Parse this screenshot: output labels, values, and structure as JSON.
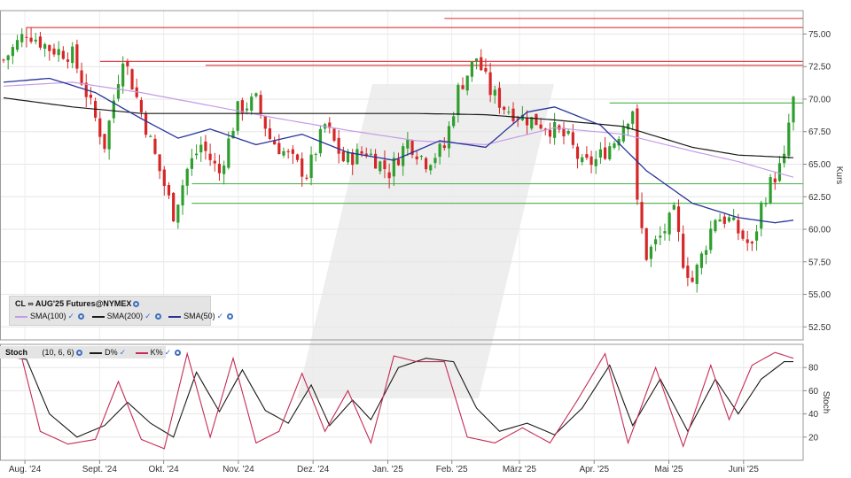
{
  "chart_data": [
    {
      "type": "candlestick",
      "title": "CL ∞ AUG'25 Futures@NYMEX",
      "ylabel": "Kurs",
      "ylim": [
        51.5,
        76.8
      ],
      "y_ticks": [
        "75.00",
        "72.50",
        "70.00",
        "67.50",
        "65.00",
        "62.50",
        "60.00",
        "57.50",
        "55.00",
        "52.50"
      ],
      "x_ticks": [
        "Aug. '24",
        "Sept. '24",
        "Okt. '24",
        "Nov. '24",
        "Dez. '24",
        "Jan. '25",
        "Feb. '25",
        "März '25",
        "Apr. '25",
        "Mai '25",
        "Juni '25"
      ],
      "grid": true,
      "legend_position": "bottom-left",
      "colors": {
        "up": "#2e9e2e",
        "down": "#d62728",
        "sma100": "#c59be8",
        "sma200": "#1a1a1a",
        "sma50": "#28349a",
        "resistance": "#e0474c",
        "support": "#5cb85c"
      },
      "price_path": [
        [
          0,
          73.0
        ],
        [
          5,
          75.2
        ],
        [
          10,
          73.9
        ],
        [
          15,
          73.4
        ],
        [
          19,
          69.5
        ],
        [
          22,
          66.5
        ],
        [
          26,
          73.4
        ],
        [
          30,
          69.0
        ],
        [
          34,
          64.5
        ],
        [
          37,
          61.2
        ],
        [
          40,
          64.6
        ],
        [
          43,
          66.5
        ],
        [
          47,
          64.3
        ],
        [
          51,
          69.2
        ],
        [
          55,
          69.9
        ],
        [
          58,
          67.0
        ],
        [
          62,
          65.6
        ],
        [
          66,
          64.2
        ],
        [
          70,
          68.0
        ],
        [
          74,
          65.3
        ],
        [
          79,
          66.0
        ],
        [
          84,
          64.4
        ],
        [
          88,
          66.8
        ],
        [
          92,
          65.2
        ],
        [
          96,
          66.3
        ],
        [
          99,
          70.7
        ],
        [
          103,
          73.2
        ],
        [
          106,
          70.6
        ],
        [
          109,
          69.4
        ],
        [
          113,
          68.6
        ],
        [
          116,
          68.3
        ],
        [
          120,
          67.6
        ],
        [
          123,
          66.9
        ],
        [
          126,
          64.9
        ],
        [
          129,
          65.3
        ],
        [
          133,
          66.8
        ],
        [
          136,
          68.7
        ],
        [
          137,
          69.3
        ],
        [
          138,
          61.8
        ],
        [
          140,
          58.0
        ],
        [
          143,
          59.4
        ],
        [
          146,
          61.2
        ],
        [
          148,
          57.6
        ],
        [
          150,
          56.0
        ],
        [
          152,
          57.9
        ],
        [
          155,
          61.0
        ],
        [
          158,
          60.7
        ],
        [
          160,
          59.8
        ],
        [
          163,
          58.5
        ],
        [
          165,
          61.8
        ],
        [
          167,
          63.5
        ],
        [
          170,
          65.3
        ],
        [
          171,
          68.1
        ],
        [
          172,
          69.9
        ]
      ],
      "candle_count": 173,
      "series": [
        {
          "name": "SMA(100)",
          "values": [
            [
              0,
              71.0
            ],
            [
              15,
              71.3
            ],
            [
              30,
              70.5
            ],
            [
              45,
              69.5
            ],
            [
              60,
              68.5
            ],
            [
              75,
              67.6
            ],
            [
              90,
              66.8
            ],
            [
              105,
              66.5
            ],
            [
              120,
              67.8
            ],
            [
              135,
              67.3
            ],
            [
              150,
              66.0
            ],
            [
              160,
              65.2
            ],
            [
              172,
              64.0
            ]
          ]
        },
        {
          "name": "SMA(200)",
          "values": [
            [
              0,
              70.1
            ],
            [
              15,
              69.4
            ],
            [
              30,
              68.9
            ],
            [
              45,
              68.9
            ],
            [
              60,
              68.9
            ],
            [
              75,
              68.9
            ],
            [
              90,
              68.9
            ],
            [
              105,
              68.8
            ],
            [
              120,
              68.4
            ],
            [
              135,
              67.9
            ],
            [
              150,
              66.3
            ],
            [
              160,
              65.7
            ],
            [
              172,
              65.5
            ]
          ]
        },
        {
          "name": "SMA(50)",
          "values": [
            [
              0,
              71.3
            ],
            [
              10,
              71.6
            ],
            [
              20,
              70.5
            ],
            [
              30,
              68.5
            ],
            [
              38,
              67.0
            ],
            [
              45,
              67.7
            ],
            [
              55,
              66.5
            ],
            [
              65,
              67.3
            ],
            [
              75,
              65.9
            ],
            [
              85,
              65.3
            ],
            [
              95,
              66.8
            ],
            [
              105,
              66.3
            ],
            [
              114,
              69.0
            ],
            [
              120,
              69.4
            ],
            [
              130,
              68.0
            ],
            [
              140,
              64.5
            ],
            [
              150,
              62.0
            ],
            [
              160,
              60.9
            ],
            [
              168,
              60.5
            ],
            [
              172,
              60.7
            ]
          ]
        }
      ],
      "horizontal_levels": [
        {
          "kind": "resistance",
          "y": 76.2,
          "x_from": 96
        },
        {
          "kind": "resistance",
          "y": 75.5,
          "x_from": 5
        },
        {
          "kind": "resistance",
          "y": 72.9,
          "x_from": 21
        },
        {
          "kind": "resistance",
          "y": 72.6,
          "x_from": 44
        },
        {
          "kind": "support",
          "y": 69.7,
          "x_from": 132
        },
        {
          "kind": "support",
          "y": 63.5,
          "x_from": 41
        },
        {
          "kind": "support",
          "y": 62.0,
          "x_from": 41
        }
      ]
    },
    {
      "type": "line",
      "title": "Stoch",
      "params": "(10, 6, 6)",
      "ylabel": "Stoch",
      "ylim": [
        0,
        100
      ],
      "y_ticks": [
        "80",
        "60",
        "40",
        "20"
      ],
      "series": [
        {
          "name": "D%",
          "color": "#1a1a1a",
          "values": [
            [
              0,
              90
            ],
            [
              5,
              87
            ],
            [
              10,
              40
            ],
            [
              16,
              20
            ],
            [
              22,
              30
            ],
            [
              27,
              50
            ],
            [
              32,
              32
            ],
            [
              37,
              20
            ],
            [
              42,
              76
            ],
            [
              47,
              42
            ],
            [
              52,
              78
            ],
            [
              57,
              43
            ],
            [
              62,
              32
            ],
            [
              67,
              65
            ],
            [
              71,
              30
            ],
            [
              76,
              52
            ],
            [
              80,
              35
            ],
            [
              86,
              80
            ],
            [
              92,
              88
            ],
            [
              98,
              85
            ],
            [
              103,
              45
            ],
            [
              108,
              25
            ],
            [
              114,
              32
            ],
            [
              120,
              22
            ],
            [
              126,
              45
            ],
            [
              132,
              82
            ],
            [
              137,
              30
            ],
            [
              143,
              70
            ],
            [
              149,
              25
            ],
            [
              155,
              70
            ],
            [
              160,
              40
            ],
            [
              165,
              70
            ],
            [
              170,
              85
            ]
          ]
        },
        {
          "name": "K%",
          "color": "#c42c55",
          "values": [
            [
              0,
              92
            ],
            [
              4,
              88
            ],
            [
              8,
              25
            ],
            [
              14,
              14
            ],
            [
              20,
              18
            ],
            [
              25,
              68
            ],
            [
              30,
              18
            ],
            [
              35,
              10
            ],
            [
              40,
              92
            ],
            [
              45,
              20
            ],
            [
              50,
              88
            ],
            [
              55,
              15
            ],
            [
              60,
              25
            ],
            [
              65,
              75
            ],
            [
              70,
              25
            ],
            [
              75,
              60
            ],
            [
              80,
              15
            ],
            [
              85,
              90
            ],
            [
              90,
              85
            ],
            [
              96,
              85
            ],
            [
              101,
              20
            ],
            [
              107,
              15
            ],
            [
              113,
              28
            ],
            [
              119,
              15
            ],
            [
              125,
              52
            ],
            [
              131,
              92
            ],
            [
              136,
              15
            ],
            [
              142,
              80
            ],
            [
              148,
              12
            ],
            [
              154,
              82
            ],
            [
              158,
              35
            ],
            [
              163,
              82
            ],
            [
              168,
              93
            ],
            [
              172,
              88
            ]
          ]
        }
      ]
    }
  ]
}
